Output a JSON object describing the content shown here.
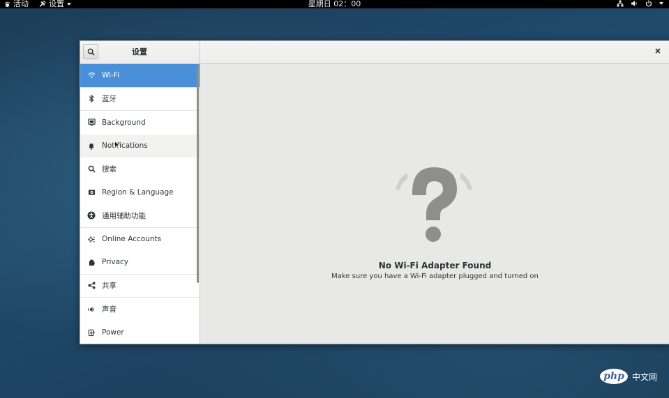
{
  "topbar": {
    "activities": "活动",
    "app_menu": "设置",
    "clock": "星期日 02：00"
  },
  "window": {
    "title": "设置"
  },
  "sidebar": {
    "items": [
      {
        "label": "Wi-Fi",
        "icon": "wifi-icon"
      },
      {
        "label": "蓝牙",
        "icon": "bluetooth-icon"
      },
      {
        "label": "Background",
        "icon": "background-icon"
      },
      {
        "label": "Notifications",
        "icon": "bell-icon"
      },
      {
        "label": "搜索",
        "icon": "search-icon"
      },
      {
        "label": "Region & Language",
        "icon": "region-icon"
      },
      {
        "label": "通用辅助功能",
        "icon": "accessibility-icon"
      },
      {
        "label": "Online Accounts",
        "icon": "online-accounts-icon"
      },
      {
        "label": "Privacy",
        "icon": "privacy-hand-icon"
      },
      {
        "label": "共享",
        "icon": "share-icon"
      },
      {
        "label": "声音",
        "icon": "speaker-icon"
      },
      {
        "label": "Power",
        "icon": "power-icon"
      }
    ],
    "selected": "Wi-Fi"
  },
  "content": {
    "empty_title": "No Wi-Fi Adapter Found",
    "empty_subtitle": "Make sure you have a Wi-Fi adapter plugged and turned on"
  },
  "watermark": {
    "logo": "php",
    "site": "中文网"
  },
  "colors": {
    "accent": "#4a90d9",
    "topbar": "#000000",
    "window_bg": "#e8e8e7"
  }
}
